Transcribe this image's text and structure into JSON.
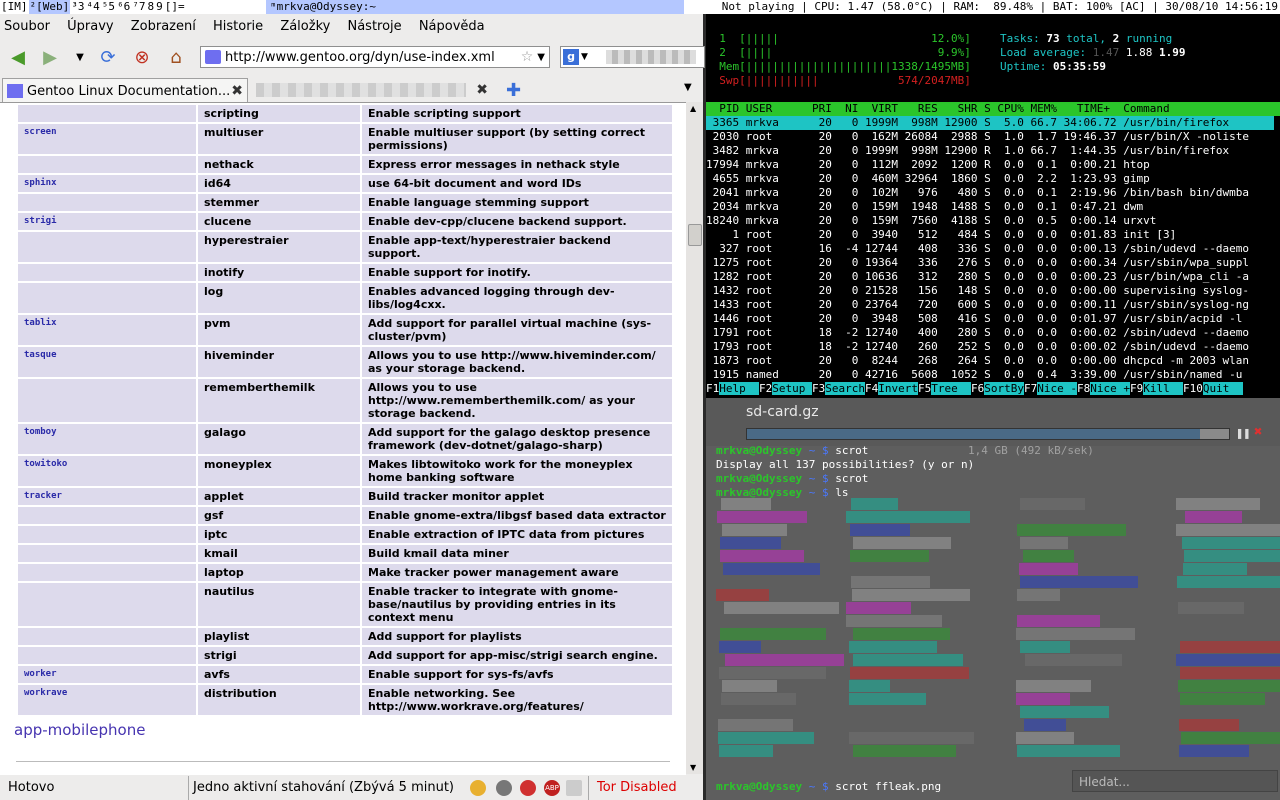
{
  "topbar": {
    "tags": [
      "[IM]",
      "²[Web]",
      "³3",
      "⁴4",
      "⁵5",
      "⁶6",
      "⁷7",
      "8",
      "9",
      "[]="
    ],
    "selected_tag": 1,
    "window_title": "ᵐmrkva@Odyssey:~",
    "status": "Not playing | CPU: 1.47 (58.0°C) | RAM:  89.48% | BAT: 100% [AC] | 30/08/10 14:56:19"
  },
  "firefox": {
    "menu": [
      "Soubor",
      "Úpravy",
      "Zobrazení",
      "Historie",
      "Záložky",
      "Nástroje",
      "Nápověda"
    ],
    "url": "http://www.gentoo.org/dyn/use-index.xml",
    "tab1_title": "Gentoo Linux Documentation...",
    "rows": [
      {
        "pkg": "",
        "flag": "scripting",
        "desc": "Enable scripting support"
      },
      {
        "pkg": "screen",
        "flag": "multiuser",
        "desc": "Enable multiuser support (by setting correct permissions)"
      },
      {
        "pkg": "",
        "flag": "nethack",
        "desc": "Express error messages in nethack style"
      },
      {
        "pkg": "sphinx",
        "flag": "id64",
        "desc": "use 64-bit document and word IDs"
      },
      {
        "pkg": "",
        "flag": "stemmer",
        "desc": "Enable language stemming support"
      },
      {
        "pkg": "strigi",
        "flag": "clucene",
        "desc": "Enable dev-cpp/clucene backend support."
      },
      {
        "pkg": "",
        "flag": "hyperestraier",
        "desc": "Enable app-text/hyperestraier backend support."
      },
      {
        "pkg": "",
        "flag": "inotify",
        "desc": "Enable support for inotify."
      },
      {
        "pkg": "",
        "flag": "log",
        "desc": "Enables advanced logging through dev-libs/log4cxx."
      },
      {
        "pkg": "tablix",
        "flag": "pvm",
        "desc": "Add support for parallel virtual machine (sys-cluster/pvm)"
      },
      {
        "pkg": "tasque",
        "flag": "hiveminder",
        "desc": "Allows you to use http://www.hiveminder.com/ as your storage backend."
      },
      {
        "pkg": "",
        "flag": "rememberthemilk",
        "desc": "Allows you to use http://www.rememberthemilk.com/ as your storage backend."
      },
      {
        "pkg": "tomboy",
        "flag": "galago",
        "desc": "Add support for the galago desktop presence framework (dev-dotnet/galago-sharp)"
      },
      {
        "pkg": "towitoko",
        "flag": "moneyplex",
        "desc": "Makes libtowitoko work for the moneyplex home banking software"
      },
      {
        "pkg": "tracker",
        "flag": "applet",
        "desc": "Build tracker monitor applet"
      },
      {
        "pkg": "",
        "flag": "gsf",
        "desc": "Enable gnome-extra/libgsf based data extractor"
      },
      {
        "pkg": "",
        "flag": "iptc",
        "desc": "Enable extraction of IPTC data from pictures"
      },
      {
        "pkg": "",
        "flag": "kmail",
        "desc": "Build kmail data miner"
      },
      {
        "pkg": "",
        "flag": "laptop",
        "desc": "Make tracker power management aware"
      },
      {
        "pkg": "",
        "flag": "nautilus",
        "desc": "Enable tracker to integrate with gnome-base/nautilus by providing entries in its context menu"
      },
      {
        "pkg": "",
        "flag": "playlist",
        "desc": "Add support for playlists"
      },
      {
        "pkg": "",
        "flag": "strigi",
        "desc": "Add support for app-misc/strigi search engine."
      },
      {
        "pkg": "worker",
        "flag": "avfs",
        "desc": "Enable support for sys-fs/avfs"
      },
      {
        "pkg": "workrave",
        "flag": "distribution",
        "desc": "Enable networking. See http://www.workrave.org/features/"
      }
    ],
    "section_heading": "app-mobilephone",
    "status_left": "Hotovo",
    "status_downloads": "Jedno aktivní stahování (Zbývá 5 minut)",
    "status_tor": "Tor Disabled"
  },
  "htop": {
    "cpu1": "  1  [|||||                       12.0%]",
    "cpu2": "  2  [||||                         9.9%]",
    "mem": "  Mem[||||||||||||||||||||||1338/1495MB]",
    "swp": "  Swp[|||||||||||            574/2047MB]",
    "tasks_label": "Tasks: ",
    "tasks_total": "73",
    "tasks_mid": " total, ",
    "tasks_running": "2",
    "tasks_end": " running",
    "load_label": "Load average: ",
    "load1": "1.47",
    "load5": " 1.88",
    "load15": " 1.99",
    "uptime_label": "Uptime: ",
    "uptime": "05:35:59",
    "header": "  PID USER      PRI  NI  VIRT   RES   SHR S CPU% MEM%   TIME+  Command",
    "selected": " 3365 mrkva      20   0 1999M  998M 12900 S  5.0 66.7 34:06.72 /usr/bin/firefox",
    "processes": [
      " 2030 root       20   0  162M 26084  2988 S  1.0  1.7 19:46.37 /usr/bin/X -noliste",
      " 3482 mrkva      20   0 1999M  998M 12900 R  1.0 66.7  1:44.35 /usr/bin/firefox",
      "17994 mrkva      20   0  112M  2092  1200 R  0.0  0.1  0:00.21 htop",
      " 4655 mrkva      20   0  460M 32964  1860 S  0.0  2.2  1:23.93 gimp",
      " 2041 mrkva      20   0  102M   976   480 S  0.0  0.1  2:19.96 /bin/bash bin/dwmba",
      " 2034 mrkva      20   0  159M  1948  1488 S  0.0  0.1  0:47.21 dwm",
      "18240 mrkva      20   0  159M  7560  4188 S  0.0  0.5  0:00.14 urxvt",
      "    1 root       20   0  3940   512   484 S  0.0  0.0  0:01.83 init [3]",
      "  327 root       16  -4 12744   408   336 S  0.0  0.0  0:00.13 /sbin/udevd --daemo",
      " 1275 root       20   0 19364   336   276 S  0.0  0.0  0:00.34 /usr/sbin/wpa_suppl",
      " 1282 root       20   0 10636   312   280 S  0.0  0.0  0:00.23 /usr/bin/wpa_cli -a",
      " 1432 root       20   0 21528   156   148 S  0.0  0.0  0:00.00 supervising syslog-",
      " 1433 root       20   0 23764   720   600 S  0.0  0.0  0:00.11 /usr/sbin/syslog-ng",
      " 1446 root       20   0  3948   508   416 S  0.0  0.0  0:01.97 /usr/sbin/acpid -l",
      " 1791 root       18  -2 12740   400   280 S  0.0  0.0  0:00.02 /sbin/udevd --daemo",
      " 1793 root       18  -2 12740   260   252 S  0.0  0.0  0:00.02 /sbin/udevd --daemo",
      " 1873 root       20   0  8244   268   264 S  0.0  0.0  0:00.00 dhcpcd -m 2003 wlan",
      " 1915 named      20   0 42716  5608  1052 S  0.0  0.4  3:39.00 /usr/sbin/named -u"
    ],
    "fkeys": [
      {
        "k": "F1",
        "v": "Help  "
      },
      {
        "k": "F2",
        "v": "Setup "
      },
      {
        "k": "F3",
        "v": "Search"
      },
      {
        "k": "F4",
        "v": "Invert"
      },
      {
        "k": "F5",
        "v": "Tree  "
      },
      {
        "k": "F6",
        "v": "SortBy"
      },
      {
        "k": "F7",
        "v": "Nice -"
      },
      {
        "k": "F8",
        "v": "Nice +"
      },
      {
        "k": "F9",
        "v": "Kill  "
      },
      {
        "k": "F10",
        "v": "Quit  "
      }
    ]
  },
  "terminal": {
    "download_name": "sd-card.gz",
    "download_progress": 0.94,
    "download_size": "1,4 GB (492 kB/sek)",
    "prompt": "mrkva@Odyssey",
    "prompt_suffix": " ~ $ ",
    "cmd1": "scrot",
    "line2": "Display all 137 possibilities? (y or n)",
    "cmd2": "scrot",
    "cmd3": "ls",
    "cmd_last": "scrot ffleak.png",
    "search_placeholder": "Hledat..."
  }
}
